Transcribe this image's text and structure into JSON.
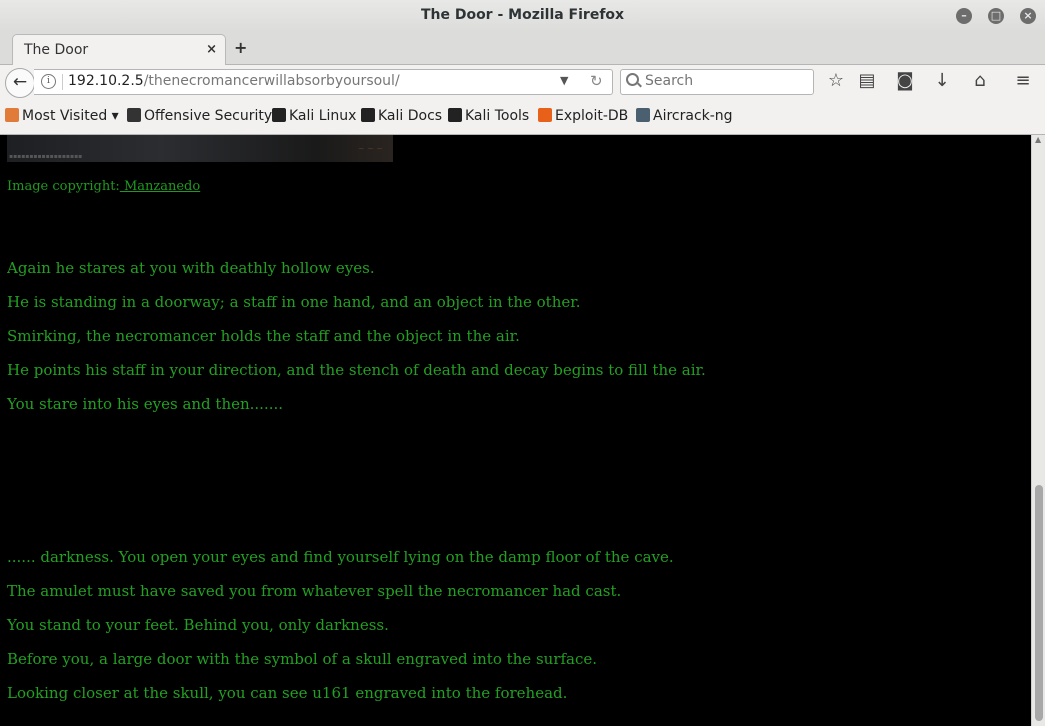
{
  "window": {
    "title": "The Door - Mozilla Firefox"
  },
  "tab": {
    "label": "The Door",
    "close": "×",
    "new": "+"
  },
  "navbar": {
    "url_host": "192.10.2.5",
    "url_path": "/thenecromancerwillabsorbyoursoul/",
    "search_placeholder": "Search"
  },
  "bookmarks": [
    {
      "label": "Most Visited ▾",
      "icon": "folder-icon",
      "color": "#e07b39"
    },
    {
      "label": "Offensive Security",
      "icon": "offsec-icon",
      "color": "#333333"
    },
    {
      "label": "Kali Linux",
      "icon": "kali-dragon-icon",
      "color": "#222222"
    },
    {
      "label": "Kali Docs",
      "icon": "kali-dragon-icon",
      "color": "#222222"
    },
    {
      "label": "Kali Tools",
      "icon": "kali-dragon-icon",
      "color": "#222222"
    },
    {
      "label": "Exploit-DB",
      "icon": "exploitdb-icon",
      "color": "#e8611a"
    },
    {
      "label": "Aircrack-ng",
      "icon": "aircrack-icon",
      "color": "#4a6070"
    }
  ],
  "content": {
    "copyright_prefix": "Image copyright:",
    "copyright_link": " Manzanedo",
    "paragraphs_top": [
      "Again he stares at you with deathly hollow eyes.",
      "He is standing in a doorway; a staff in one hand, and an object in the other.",
      "Smirking, the necromancer holds the staff and the object in the air.",
      "He points his staff in your direction, and the stench of death and decay begins to fill the air.",
      "You stare into his eyes and then......."
    ],
    "paragraphs_bottom": [
      "...... darkness. You open your eyes and find yourself lying on the damp floor of the cave.",
      "The amulet must have saved you from whatever spell the necromancer had cast.",
      "You stand to your feet. Behind you, only darkness.",
      "Before you, a large door with the symbol of a skull engraved into the surface.",
      "Looking closer at the skull, you can see u161 engraved into the forehead."
    ]
  },
  "colors": {
    "text": "#23a023",
    "background": "#000000"
  }
}
